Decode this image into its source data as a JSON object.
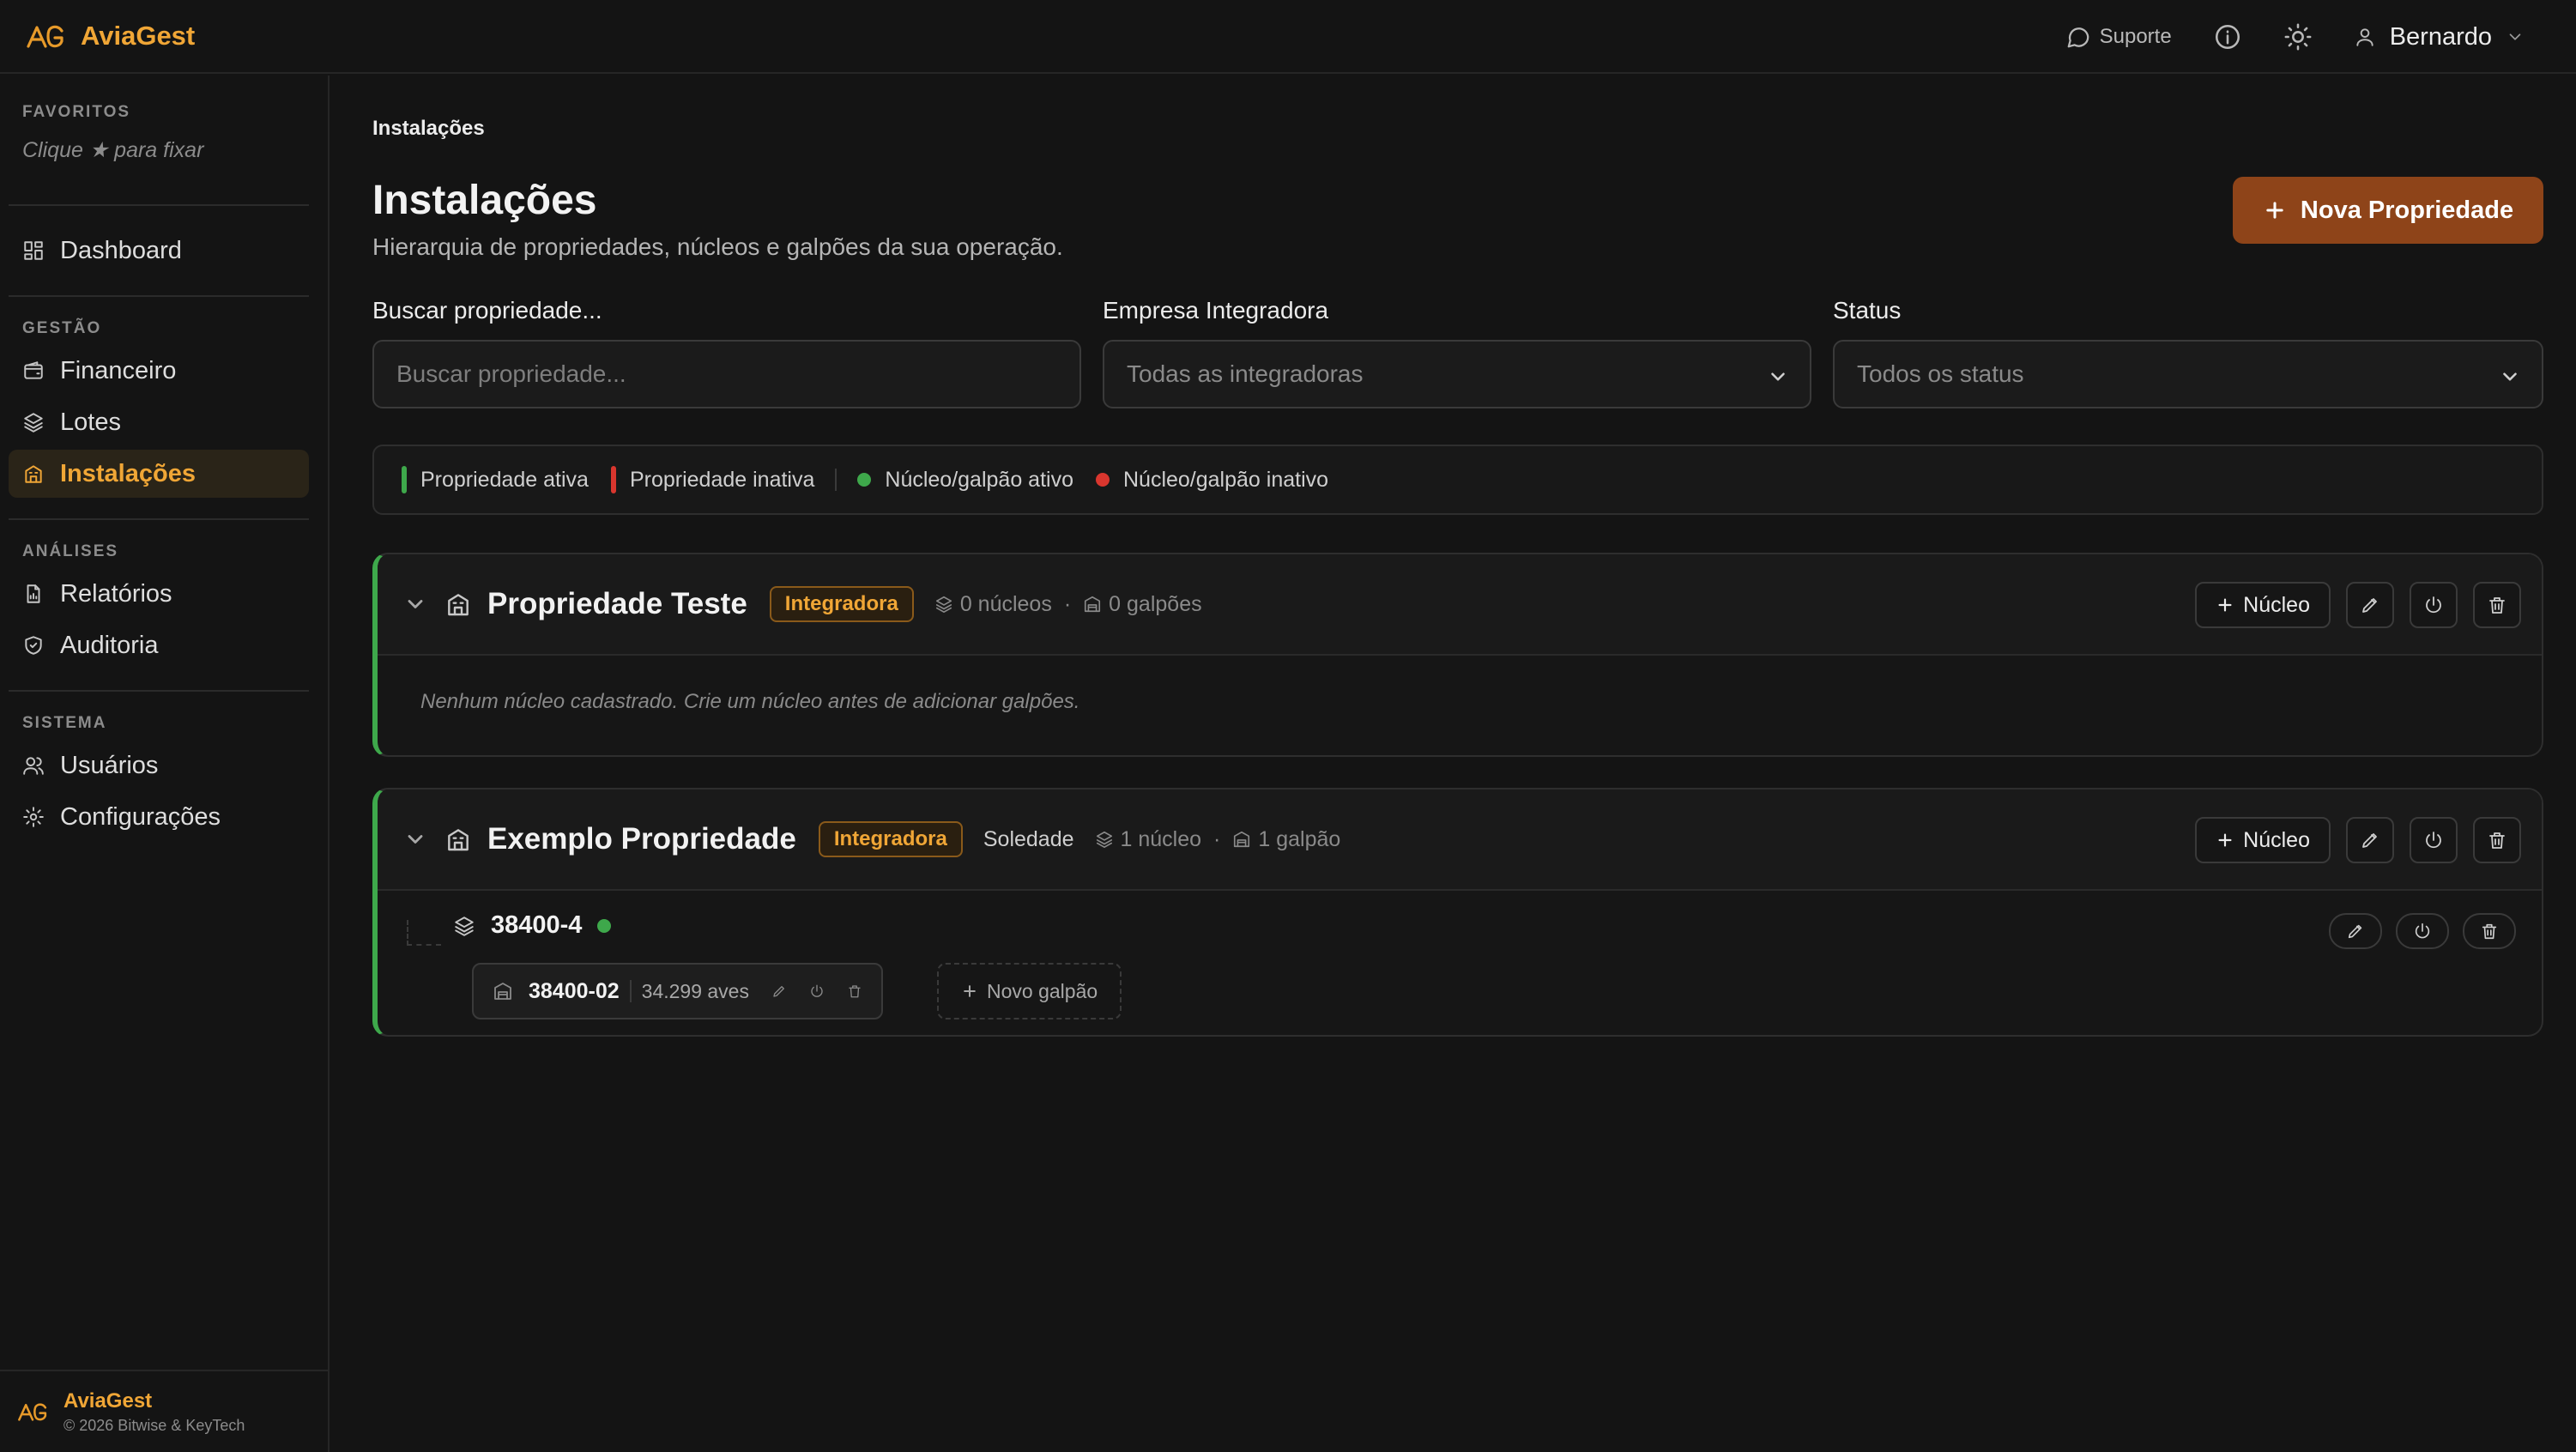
{
  "app": {
    "name": "AviaGest"
  },
  "topbar": {
    "support_label": "Suporte",
    "user_name": "Bernardo"
  },
  "sidebar": {
    "favorites_title": "FAVORITOS",
    "favorites_hint": "Clique ★ para fixar",
    "dashboard": "Dashboard",
    "gestao_title": "GESTÃO",
    "gestao_items": [
      "Financeiro",
      "Lotes",
      "Instalações"
    ],
    "analises_title": "ANÁLISES",
    "analises_items": [
      "Relatórios",
      "Auditoria"
    ],
    "sistema_title": "SISTEMA",
    "sistema_items": [
      "Usuários",
      "Configurações"
    ],
    "active_item": "Instalações",
    "footer_name": "AviaGest",
    "footer_copy": "© 2026 Bitwise & KeyTech"
  },
  "page": {
    "breadcrumb": "Instalações",
    "title": "Instalações",
    "subtitle": "Hierarquia de propriedades, núcleos e galpões da sua operação.",
    "new_button": "Nova Propriedade"
  },
  "filters": {
    "search_label": "Buscar propriedade...",
    "search_placeholder": "Buscar propriedade...",
    "company_label": "Empresa Integradora",
    "company_value": "Todas as integradoras",
    "status_label": "Status",
    "status_value": "Todos os status"
  },
  "legend": {
    "active_property": "Propriedade ativa",
    "inactive_property": "Propriedade inativa",
    "active_unit": "Núcleo/galpão ativo",
    "inactive_unit": "Núcleo/galpão inativo"
  },
  "colors": {
    "accent": "#f0a636",
    "primary_button": "#8e4419",
    "active": "#3ea84b",
    "inactive": "#d9362e"
  },
  "properties": [
    {
      "name": "Propriedade Teste",
      "badge": "Integradora",
      "nucleos": "0 núcleos",
      "galpoes": "0 galpões",
      "add_nucleo": "Núcleo",
      "empty_message": "Nenhum núcleo cadastrado. Crie um núcleo antes de adicionar galpões."
    },
    {
      "name": "Exemplo Propriedade",
      "badge": "Integradora",
      "city": "Soledade",
      "nucleos": "1 núcleo",
      "galpoes": "1 galpão",
      "add_nucleo": "Núcleo",
      "nucleo": {
        "name": "38400-4",
        "galpao": {
          "name": "38400-02",
          "aves": "34.299 aves"
        },
        "new_galpao": "Novo galpão"
      }
    }
  ]
}
